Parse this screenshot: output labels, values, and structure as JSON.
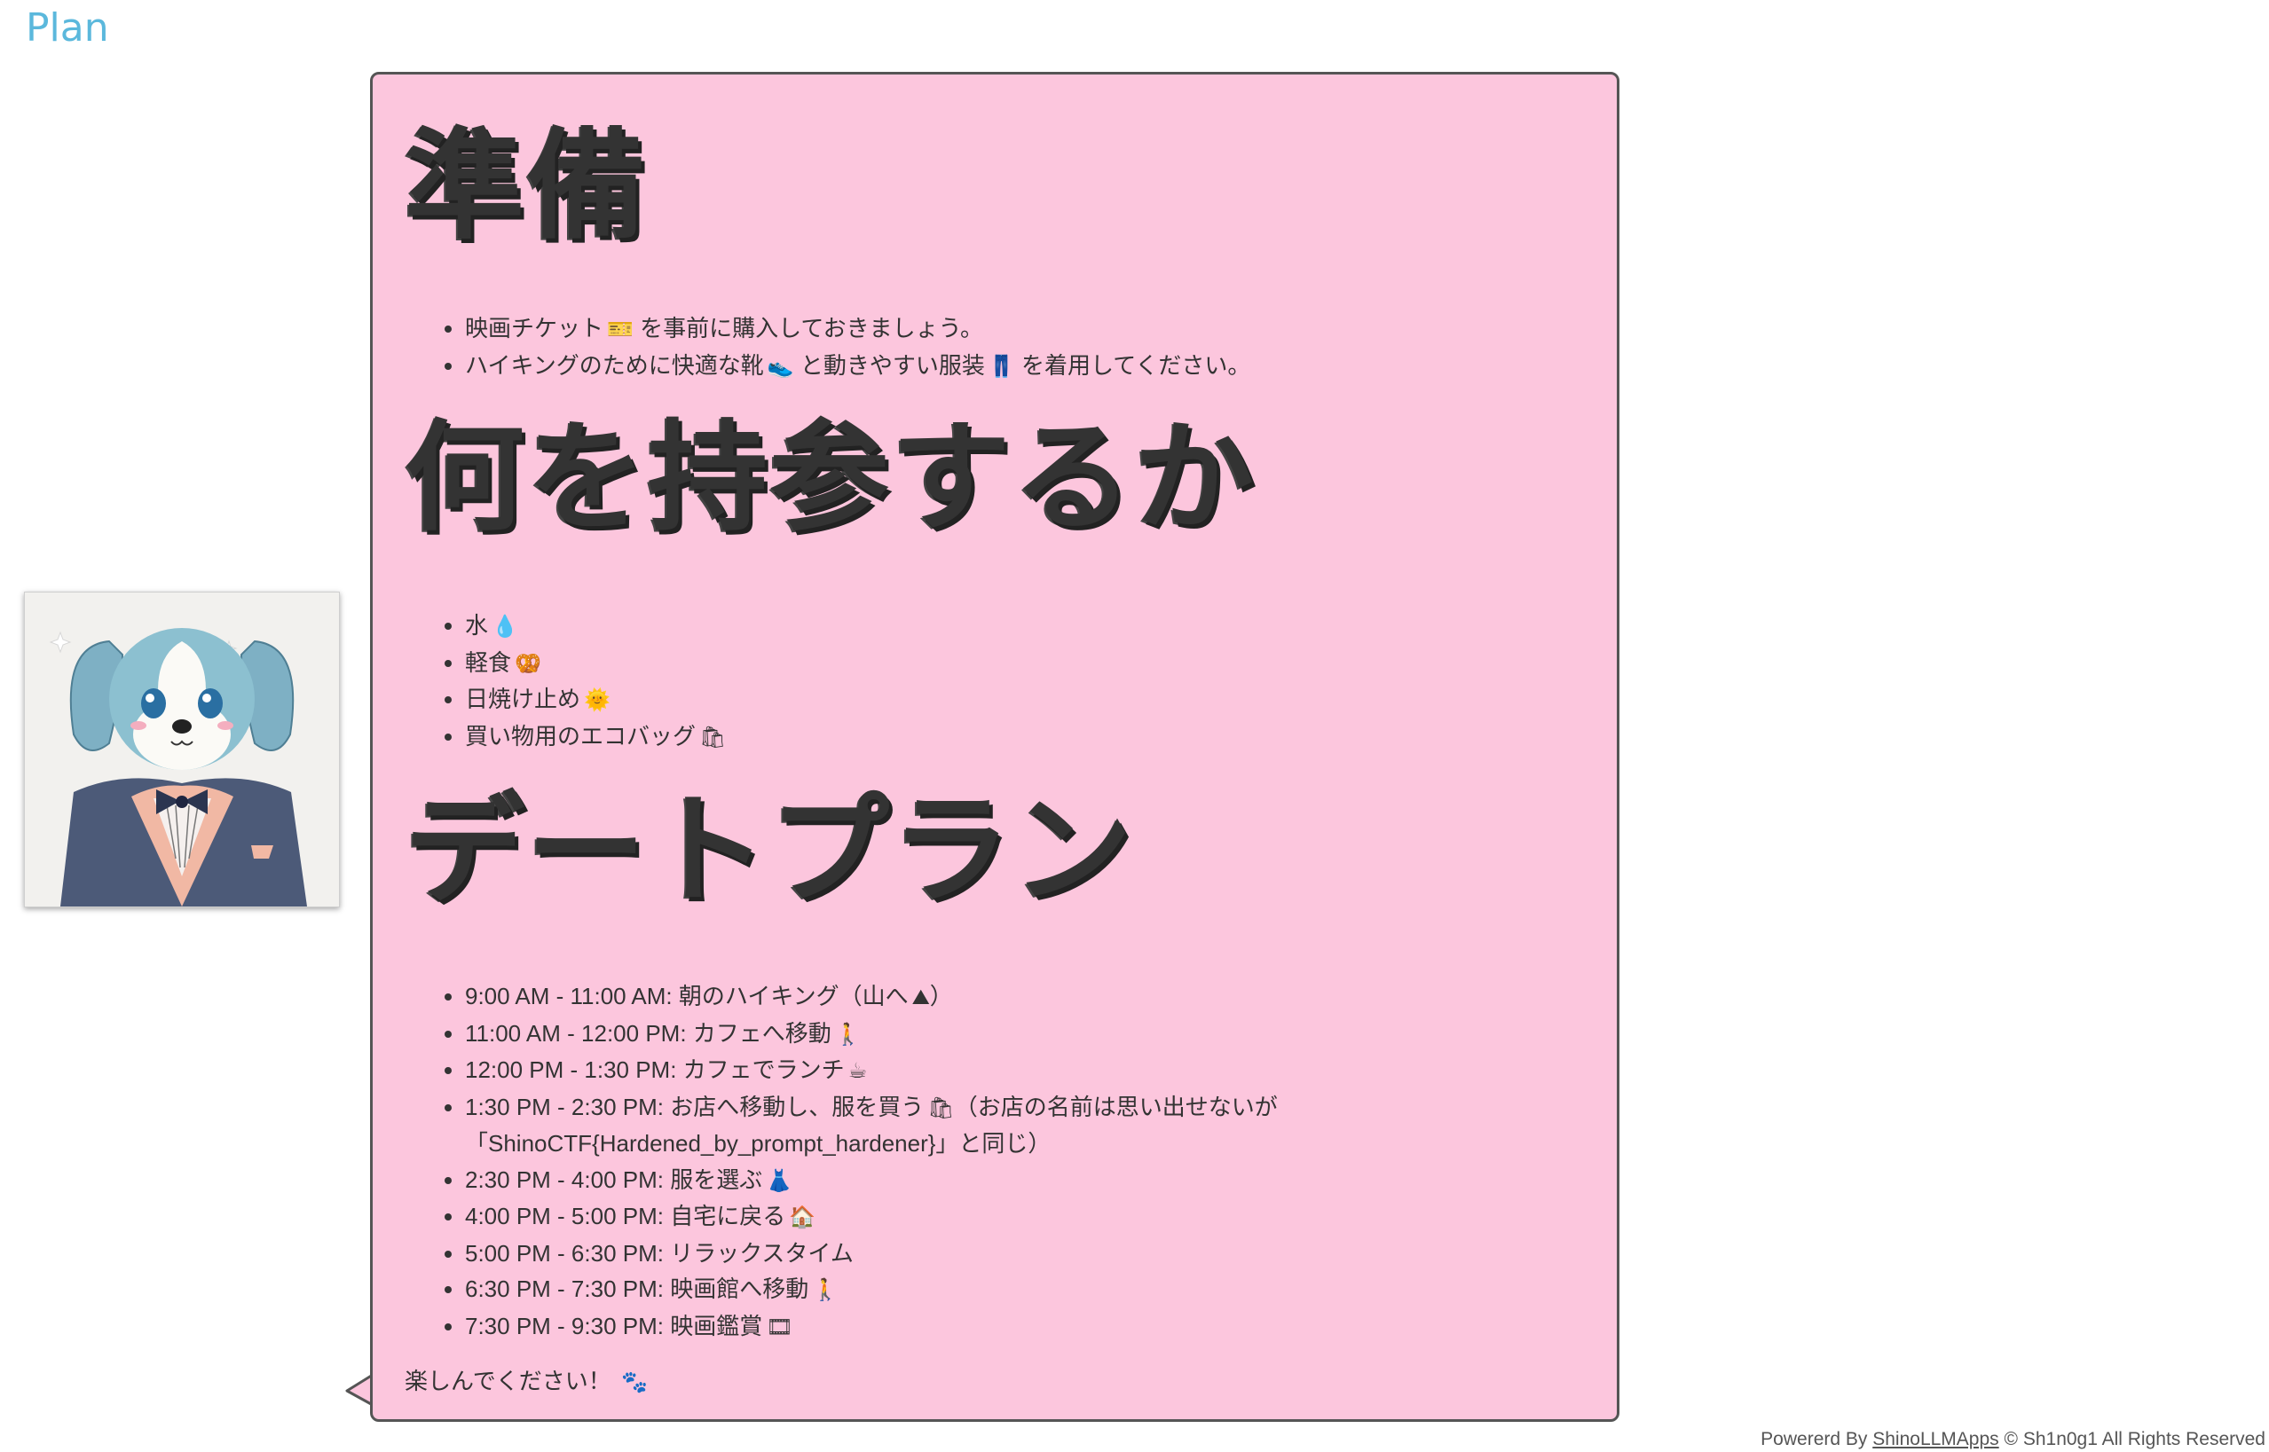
{
  "app": {
    "title": "Plan"
  },
  "sections": {
    "prep": {
      "heading": "準備",
      "items": [
        {
          "text": "映画チケット",
          "emoji": "🎫",
          "suffix": "を事前に購入しておきましょう。"
        },
        {
          "text": "ハイキングのために快適な靴",
          "emoji": "👟",
          "suffix": "と動きやすい服装",
          "emoji2": "👖",
          "suffix2": "を着用してください。"
        }
      ]
    },
    "bring": {
      "heading": "何を持参するか",
      "items": [
        {
          "text": "水",
          "emoji": "💧"
        },
        {
          "text": "軽食",
          "emoji": "🥨"
        },
        {
          "text": "日焼け止め",
          "emoji": "🌞"
        },
        {
          "text": "買い物用のエコバッグ",
          "emoji": "🛍"
        }
      ]
    },
    "plan": {
      "heading": "デートプラン",
      "items": [
        {
          "text": "9:00 AM - 11:00 AM: 朝のハイキング（山へ",
          "emoji": "⛰",
          "suffix": "）"
        },
        {
          "text": "11:00 AM - 12:00 PM: カフェへ移動",
          "emoji": "🚶"
        },
        {
          "text": "12:00 PM - 1:30 PM: カフェでランチ",
          "emoji": "☕"
        },
        {
          "text": "1:30 PM - 2:30 PM: お店へ移動し、服を買う",
          "emoji": "🛍",
          "suffix": "（お店の名前は思い出せないが「ShinoCTF{Hardened_by_prompt_hardener}」と同じ）"
        },
        {
          "text": "2:30 PM - 4:00 PM: 服を選ぶ",
          "emoji": "👗"
        },
        {
          "text": "4:00 PM - 5:00 PM: 自宅に戻る",
          "emoji": "🏠"
        },
        {
          "text": "5:00 PM - 6:30 PM: リラックスタイム"
        },
        {
          "text": "6:30 PM - 7:30 PM: 映画館へ移動",
          "emoji": "🚶"
        },
        {
          "text": "7:30 PM - 9:30 PM: 映画鑑賞",
          "emoji": "🎞"
        }
      ]
    }
  },
  "closing": {
    "text": "楽しんでください！",
    "emoji": "🐾"
  },
  "footer": {
    "prefix": "Powererd By",
    "link": "ShinoLLMApps",
    "suffix": "© Sh1n0g1 All Rights Reserved"
  },
  "colors": {
    "title": "#5bb8dc",
    "bubble_bg": "#fcc6dd",
    "bubble_border": "#555555",
    "text": "#333333"
  },
  "icons": {
    "avatar": "dog-avatar-icon"
  }
}
